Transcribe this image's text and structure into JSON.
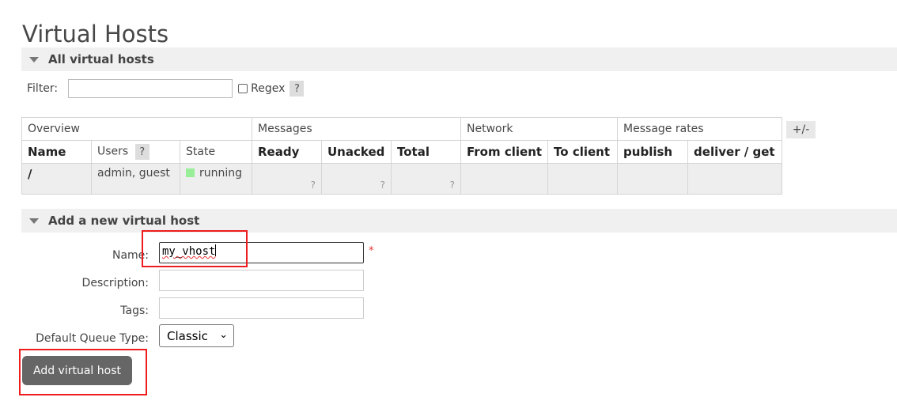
{
  "page_title": "Virtual Hosts",
  "all_vhosts_section": {
    "title": "All virtual hosts",
    "filter_label": "Filter:",
    "filter_value": "",
    "regex_label": "Regex",
    "help_mark": "?"
  },
  "table": {
    "groups": [
      "Overview",
      "Messages",
      "Network",
      "Message rates"
    ],
    "columns": [
      "Name",
      "Users",
      "State",
      "Ready",
      "Unacked",
      "Total",
      "From client",
      "To client",
      "publish",
      "deliver / get"
    ],
    "rows": [
      {
        "name": "/",
        "users": "admin, guest",
        "state": "running",
        "ready": "?",
        "unacked": "?",
        "total": "?",
        "from_client": "",
        "to_client": "",
        "publish": "",
        "deliver_get": ""
      }
    ],
    "plus_minus": "+/-"
  },
  "add_section": {
    "title": "Add a new virtual host",
    "name_label": "Name:",
    "name_value": "my_vhost",
    "required_mark": "*",
    "description_label": "Description:",
    "description_value": "",
    "tags_label": "Tags:",
    "tags_value": "",
    "queue_type_label": "Default Queue Type:",
    "queue_type_value": "Classic",
    "submit_label": "Add virtual host"
  },
  "colors": {
    "running": "#99ee99",
    "highlight": "#ee1c1c",
    "button": "#666666"
  }
}
